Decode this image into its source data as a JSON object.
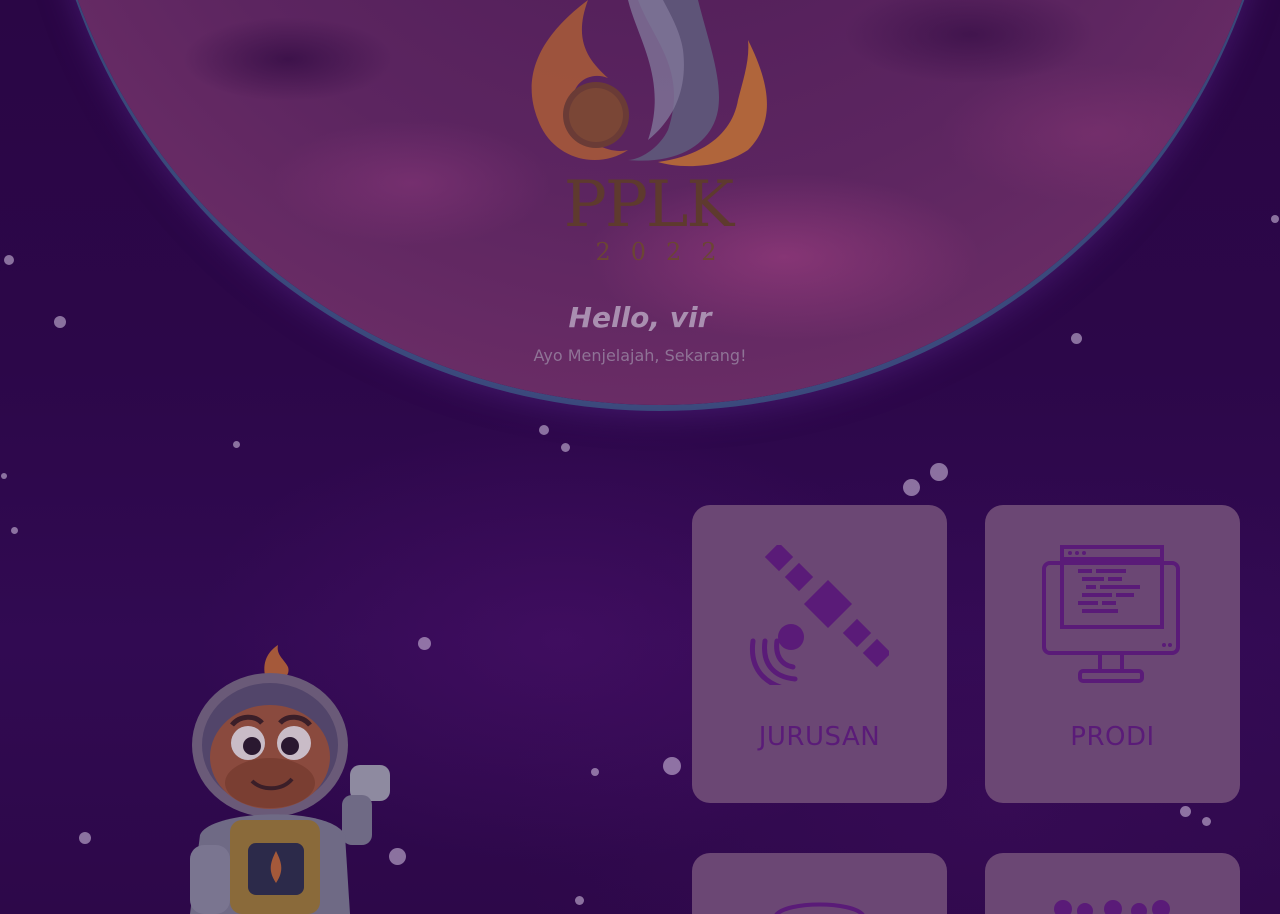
{
  "logo": {
    "title": "PPLK",
    "year": "2022"
  },
  "welcome": {
    "greeting": "Hello, vir",
    "subtitle": "Ayo Menjelajah, Sekarang!"
  },
  "menu": {
    "cards": [
      {
        "label": "JURUSAN",
        "icon": "satellite-icon"
      },
      {
        "label": "PRODI",
        "icon": "computer-monitor-icon"
      },
      {
        "label": "",
        "icon": "globe-icon"
      },
      {
        "label": "",
        "icon": "people-icon"
      }
    ]
  },
  "colors": {
    "background": "#2a0645",
    "card": "#6b4774",
    "card_label": "#5a1b78",
    "icon": "#4a1466"
  }
}
